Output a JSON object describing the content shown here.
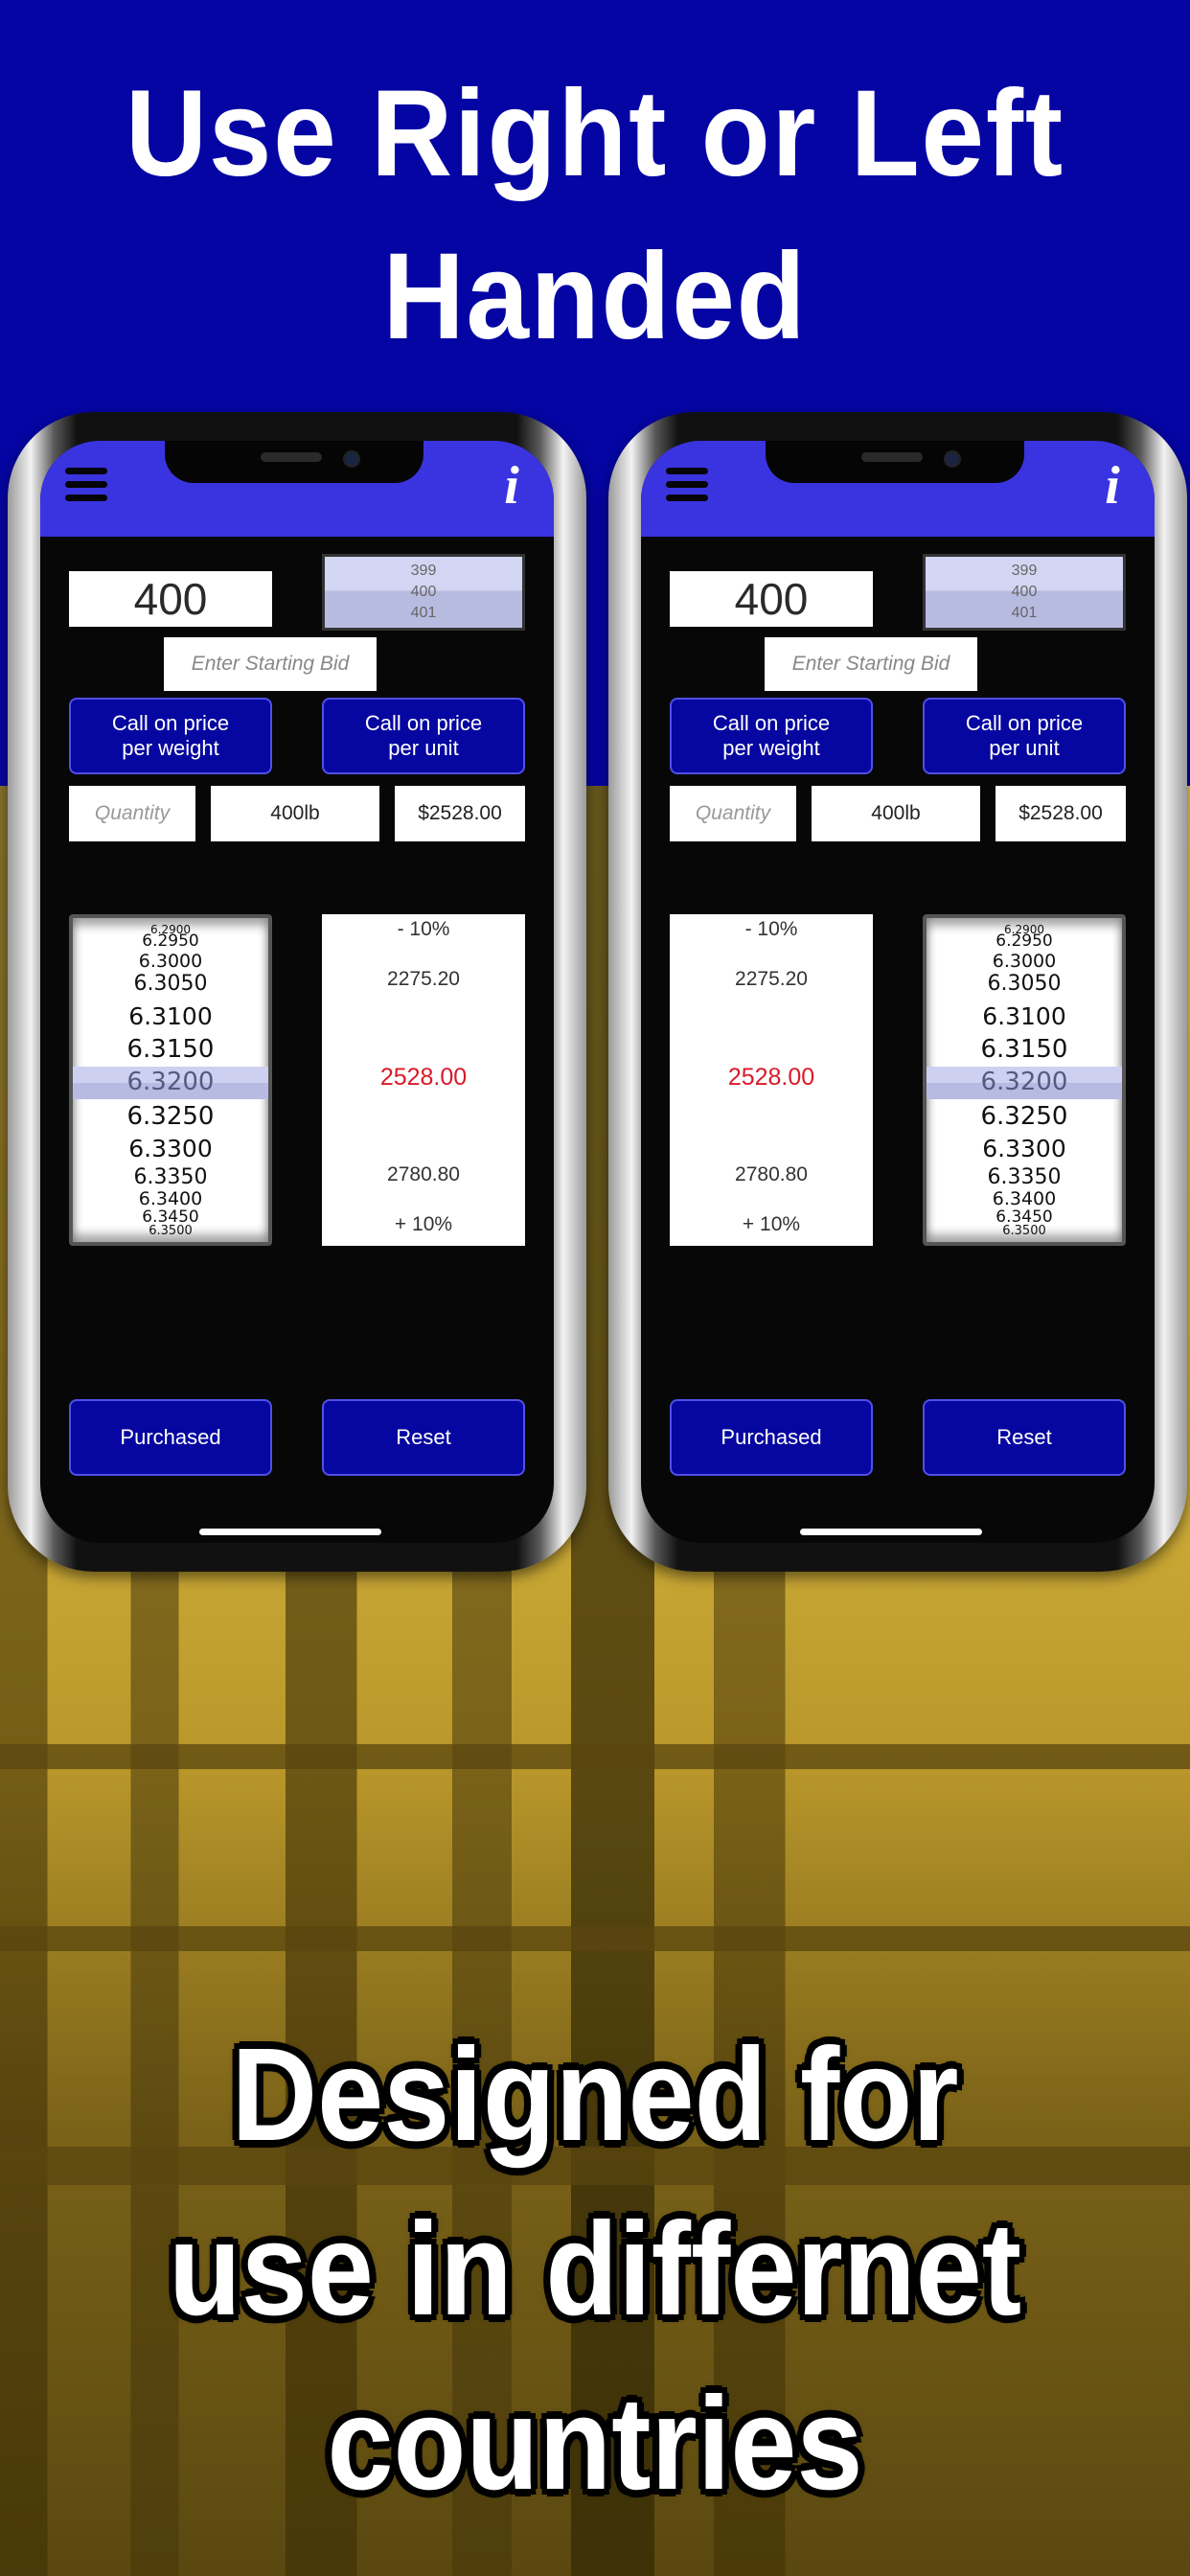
{
  "headline_top": "Use Right or Left Handed",
  "headline_top_lines": [
    "Use Right or Left",
    "Handed"
  ],
  "headline_bottom_lines": [
    "Designed for",
    "use in differnet",
    "countries"
  ],
  "colors": {
    "banner_blue": "#0505a4",
    "appbar_blue": "#3a34e0",
    "button_blue": "#0606a0",
    "button_border": "#5050e6",
    "highlight_red": "#d81a2a",
    "photo_tint": "#d9b840"
  },
  "app": {
    "menu_icon": "hamburger-menu-icon",
    "info_icon": "info-icon",
    "info_glyph": "i",
    "quantity_value": "400",
    "quantity_picker": [
      "399",
      "400",
      "401"
    ],
    "starting_bid_placeholder": "Enter Starting Bid",
    "call_weight_label": "Call on price per weight",
    "call_unit_label": "Call on price per unit",
    "quantity_placeholder": "Quantity",
    "weight_value": "400lb",
    "total_value": "$2528.00",
    "rate_options": [
      "6.2900",
      "6.2950",
      "6.3000",
      "6.3050",
      "6.3100",
      "6.3150",
      "6.3200",
      "6.3250",
      "6.3300",
      "6.3350",
      "6.3400",
      "6.3450",
      "6.3500"
    ],
    "rate_selected": "6.3200",
    "range": {
      "minus_label": "- 10%",
      "low_value": "2275.20",
      "current_value": "2528.00",
      "high_value": "2780.80",
      "plus_label": "+ 10%"
    },
    "purchased_label": "Purchased",
    "reset_label": "Reset"
  },
  "phones": [
    {
      "id": "left",
      "layout": "right-handed",
      "rate_picker_side": "left"
    },
    {
      "id": "right",
      "layout": "left-handed",
      "rate_picker_side": "right"
    }
  ]
}
